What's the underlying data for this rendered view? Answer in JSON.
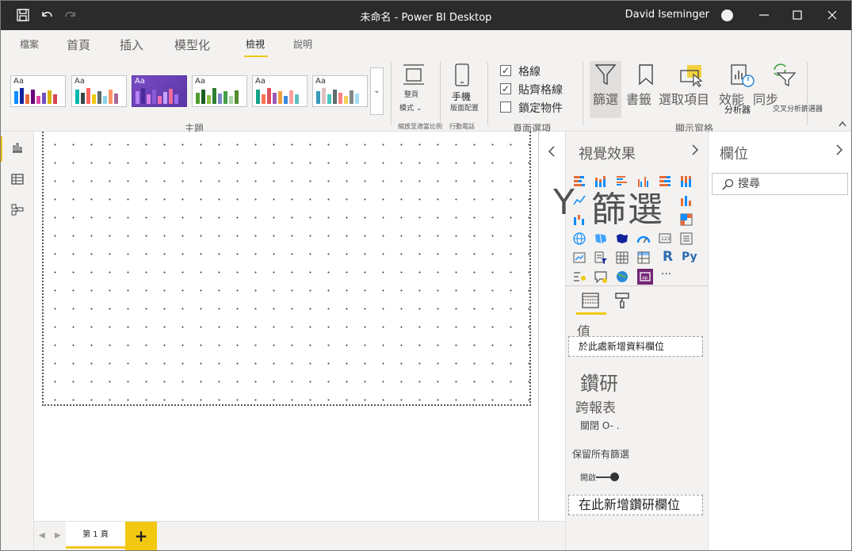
{
  "titlebar": {
    "title": "未命名 -  Power BI Desktop",
    "user": "David Iseminger"
  },
  "tabs": [
    {
      "label": "檔案"
    },
    {
      "label": "首頁"
    },
    {
      "label": "插入"
    },
    {
      "label": "模型化"
    },
    {
      "label": "檢視"
    },
    {
      "label": "說明"
    }
  ],
  "ribbon": {
    "themes_group": "主題",
    "theme_sample": "Aa",
    "page_view": {
      "line1": "整頁",
      "line2": "模式 ⌄"
    },
    "scale_group": "縮放至適當比例",
    "phone": {
      "line1": "手機",
      "line2": "版面配置"
    },
    "phone_group": "行動電話",
    "gridlines": "格線",
    "snap": "貼齊格線",
    "lock": "鎖定物件",
    "page_options_group": "頁面選項",
    "filters": "篩選",
    "bookmarks": "書籤",
    "selection": "選取項目",
    "performance": "效能",
    "performance_sub": "分析器",
    "sync": "同步",
    "sync_sub": "交叉分析篩選器",
    "show_panes_group": "顯示窗格"
  },
  "pages": {
    "page1": "第 1 頁",
    "add": "+"
  },
  "viz": {
    "title": "視覺效果",
    "overlay_y": "Y",
    "overlay_filter": "篩選",
    "r_label": "R",
    "py_label": "Py",
    "more": "···",
    "values_label": "值",
    "values_drop": "於此處新增資料欄位",
    "drill_heading": "鑽研",
    "cross_report": "跨報表",
    "cross_value": "關閉 O- .",
    "keep_filters": "保留所有篩選",
    "toggle_on": "開啟",
    "drill_drop": "在此新增鑽研欄位"
  },
  "fields": {
    "title": "欄位",
    "search_placeholder": "搜尋"
  },
  "colors": {
    "accent": "#f2c811",
    "titlebar": "#2b2b2b",
    "pane": "#f3f2f1"
  }
}
